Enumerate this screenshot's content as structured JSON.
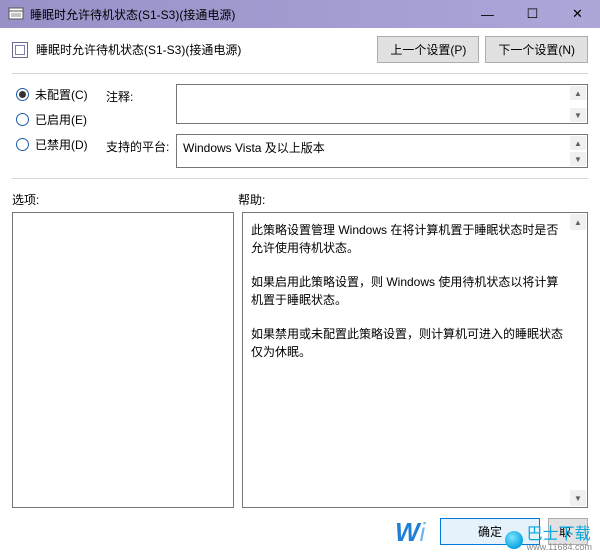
{
  "window": {
    "title": "睡眠时允许待机状态(S1-S3)(接通电源)"
  },
  "header": {
    "title": "睡眠时允许待机状态(S1-S3)(接通电源)",
    "prev_btn": "上一个设置(P)",
    "next_btn": "下一个设置(N)"
  },
  "radios": {
    "not_configured": "未配置(C)",
    "enabled": "已启用(E)",
    "disabled": "已禁用(D)",
    "selected": "not_configured"
  },
  "fields": {
    "comment_label": "注释:",
    "comment_value": "",
    "supported_label": "支持的平台:",
    "supported_value": "Windows Vista 及以上版本"
  },
  "labels": {
    "options": "选项:",
    "help": "帮助:"
  },
  "help": {
    "p1": "此策略设置管理 Windows 在将计算机置于睡眠状态时是否允许使用待机状态。",
    "p2": "如果启用此策略设置，则 Windows 使用待机状态以将计算机置于睡眠状态。",
    "p3": "如果禁用或未配置此策略设置，则计算机可进入的睡眠状态仅为休眠。"
  },
  "footer": {
    "ok": "确定",
    "cancel_partial": "取"
  },
  "watermark": {
    "w_text": "W",
    "i_text": "i",
    "site": "巴士下载",
    "url": "www.11684.com"
  }
}
